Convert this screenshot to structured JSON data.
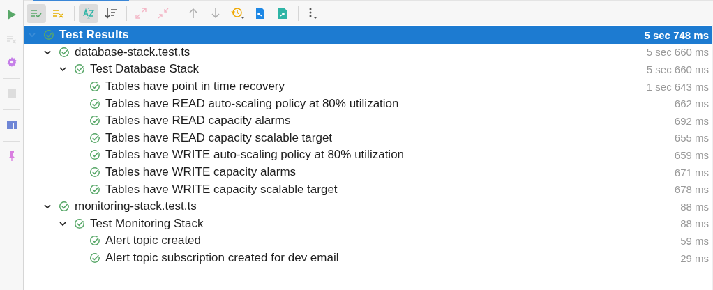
{
  "sidebar": {
    "buttons": [
      {
        "disabled": false
      },
      {
        "disabled": true
      },
      {
        "disabled": false
      },
      {
        "disabled": true
      },
      {
        "disabled": false
      },
      {
        "disabled": false
      }
    ]
  },
  "toolbar": {
    "buttons": [
      {
        "on": true,
        "disabled": false
      },
      {
        "on": false,
        "disabled": false
      },
      {
        "on": true,
        "disabled": false
      },
      {
        "on": false,
        "disabled": false
      },
      {
        "on": false,
        "disabled": true
      },
      {
        "on": false,
        "disabled": true
      },
      {
        "on": false,
        "disabled": true
      },
      {
        "on": false,
        "disabled": true
      },
      {
        "on": false,
        "disabled": false
      },
      {
        "on": false,
        "disabled": false
      },
      {
        "on": false,
        "disabled": false
      },
      {
        "on": false,
        "disabled": false
      }
    ]
  },
  "tree": [
    {
      "label": "Test Results",
      "duration": "5 sec 748 ms",
      "passed": true,
      "selected": true,
      "expanded": true,
      "children": [
        {
          "label": "database-stack.test.ts",
          "duration": "5 sec 660 ms",
          "passed": true,
          "selected": false,
          "expanded": true,
          "children": [
            {
              "label": "Test Database Stack",
              "duration": "5 sec 660 ms",
              "passed": true,
              "selected": false,
              "expanded": true,
              "children": [
                {
                  "label": "Tables have point in time recovery",
                  "duration": "1 sec 643 ms",
                  "passed": true,
                  "selected": false
                },
                {
                  "label": "Tables have READ auto-scaling policy at 80% utilization",
                  "duration": "662 ms",
                  "passed": true,
                  "selected": false
                },
                {
                  "label": "Tables have READ capacity alarms",
                  "duration": "692 ms",
                  "passed": true,
                  "selected": false
                },
                {
                  "label": "Tables have READ capacity scalable target",
                  "duration": "655 ms",
                  "passed": true,
                  "selected": false
                },
                {
                  "label": "Tables have WRITE auto-scaling policy at 80% utilization",
                  "duration": "659 ms",
                  "passed": true,
                  "selected": false
                },
                {
                  "label": "Tables have WRITE capacity alarms",
                  "duration": "671 ms",
                  "passed": true,
                  "selected": false
                },
                {
                  "label": "Tables have WRITE capacity scalable target",
                  "duration": "678 ms",
                  "passed": true,
                  "selected": false
                }
              ]
            }
          ]
        },
        {
          "label": "monitoring-stack.test.ts",
          "duration": "88 ms",
          "passed": true,
          "selected": false,
          "expanded": true,
          "children": [
            {
              "label": "Test Monitoring Stack",
              "duration": "88 ms",
              "passed": true,
              "selected": false,
              "expanded": true,
              "children": [
                {
                  "label": "Alert topic created",
                  "duration": "59 ms",
                  "passed": true,
                  "selected": false
                },
                {
                  "label": "Alert topic subscription created for dev email",
                  "duration": "29 ms",
                  "passed": true,
                  "selected": false
                }
              ]
            }
          ]
        }
      ]
    }
  ]
}
